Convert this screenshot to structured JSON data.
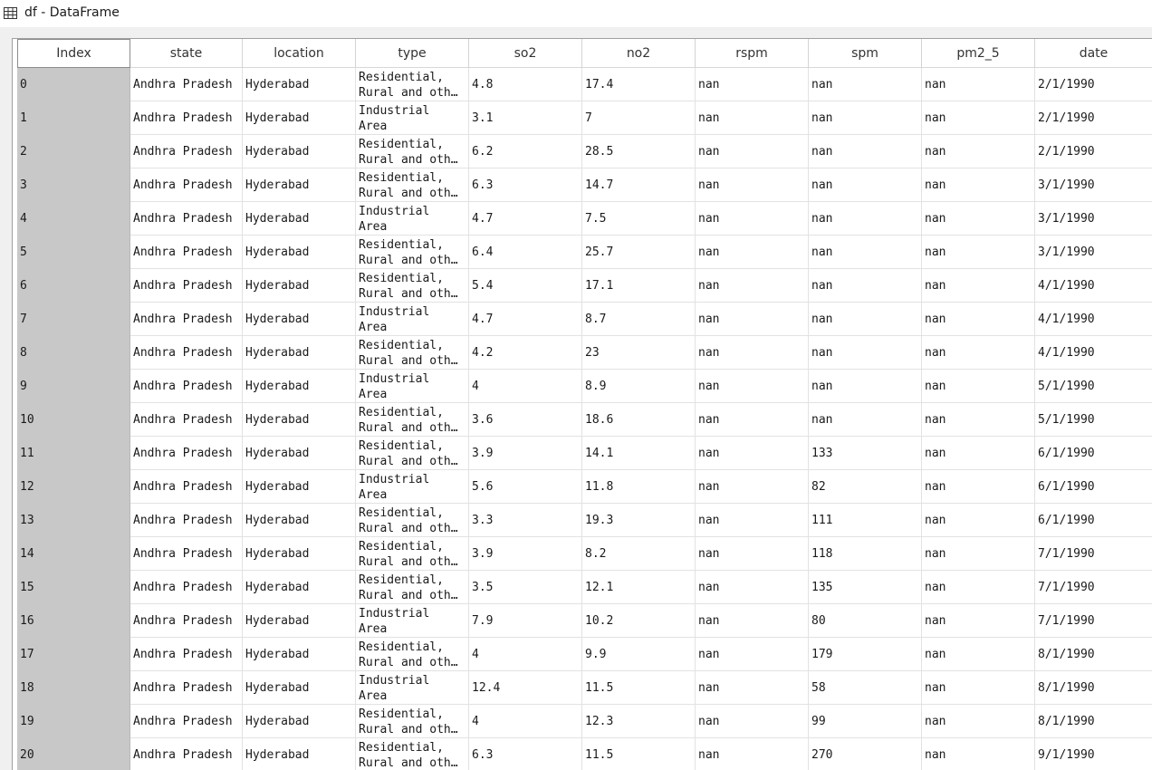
{
  "window": {
    "title": "df - DataFrame",
    "icon": "table-grid-icon"
  },
  "columns": [
    "Index",
    "state",
    "location",
    "type",
    "so2",
    "no2",
    "rspm",
    "spm",
    "pm2_5",
    "date"
  ],
  "rows": [
    {
      "index": "0",
      "state": "Andhra Pradesh",
      "location": "Hyderabad",
      "type1": "Residential,",
      "type2": "Rural and oth…",
      "so2": "4.8",
      "no2": "17.4",
      "rspm": "nan",
      "spm": "nan",
      "pm2_5": "nan",
      "date": "2/1/1990"
    },
    {
      "index": "1",
      "state": "Andhra Pradesh",
      "location": "Hyderabad",
      "type1": "Industrial",
      "type2": "Area",
      "so2": "3.1",
      "no2": "7",
      "rspm": "nan",
      "spm": "nan",
      "pm2_5": "nan",
      "date": "2/1/1990"
    },
    {
      "index": "2",
      "state": "Andhra Pradesh",
      "location": "Hyderabad",
      "type1": "Residential,",
      "type2": "Rural and oth…",
      "so2": "6.2",
      "no2": "28.5",
      "rspm": "nan",
      "spm": "nan",
      "pm2_5": "nan",
      "date": "2/1/1990"
    },
    {
      "index": "3",
      "state": "Andhra Pradesh",
      "location": "Hyderabad",
      "type1": "Residential,",
      "type2": "Rural and oth…",
      "so2": "6.3",
      "no2": "14.7",
      "rspm": "nan",
      "spm": "nan",
      "pm2_5": "nan",
      "date": "3/1/1990"
    },
    {
      "index": "4",
      "state": "Andhra Pradesh",
      "location": "Hyderabad",
      "type1": "Industrial",
      "type2": "Area",
      "so2": "4.7",
      "no2": "7.5",
      "rspm": "nan",
      "spm": "nan",
      "pm2_5": "nan",
      "date": "3/1/1990"
    },
    {
      "index": "5",
      "state": "Andhra Pradesh",
      "location": "Hyderabad",
      "type1": "Residential,",
      "type2": "Rural and oth…",
      "so2": "6.4",
      "no2": "25.7",
      "rspm": "nan",
      "spm": "nan",
      "pm2_5": "nan",
      "date": "3/1/1990"
    },
    {
      "index": "6",
      "state": "Andhra Pradesh",
      "location": "Hyderabad",
      "type1": "Residential,",
      "type2": "Rural and oth…",
      "so2": "5.4",
      "no2": "17.1",
      "rspm": "nan",
      "spm": "nan",
      "pm2_5": "nan",
      "date": "4/1/1990"
    },
    {
      "index": "7",
      "state": "Andhra Pradesh",
      "location": "Hyderabad",
      "type1": "Industrial",
      "type2": "Area",
      "so2": "4.7",
      "no2": "8.7",
      "rspm": "nan",
      "spm": "nan",
      "pm2_5": "nan",
      "date": "4/1/1990"
    },
    {
      "index": "8",
      "state": "Andhra Pradesh",
      "location": "Hyderabad",
      "type1": "Residential,",
      "type2": "Rural and oth…",
      "so2": "4.2",
      "no2": "23",
      "rspm": "nan",
      "spm": "nan",
      "pm2_5": "nan",
      "date": "4/1/1990"
    },
    {
      "index": "9",
      "state": "Andhra Pradesh",
      "location": "Hyderabad",
      "type1": "Industrial",
      "type2": "Area",
      "so2": "4",
      "no2": "8.9",
      "rspm": "nan",
      "spm": "nan",
      "pm2_5": "nan",
      "date": "5/1/1990"
    },
    {
      "index": "10",
      "state": "Andhra Pradesh",
      "location": "Hyderabad",
      "type1": "Residential,",
      "type2": "Rural and oth…",
      "so2": "3.6",
      "no2": "18.6",
      "rspm": "nan",
      "spm": "nan",
      "pm2_5": "nan",
      "date": "5/1/1990"
    },
    {
      "index": "11",
      "state": "Andhra Pradesh",
      "location": "Hyderabad",
      "type1": "Residential,",
      "type2": "Rural and oth…",
      "so2": "3.9",
      "no2": "14.1",
      "rspm": "nan",
      "spm": "133",
      "pm2_5": "nan",
      "date": "6/1/1990"
    },
    {
      "index": "12",
      "state": "Andhra Pradesh",
      "location": "Hyderabad",
      "type1": "Industrial",
      "type2": "Area",
      "so2": "5.6",
      "no2": "11.8",
      "rspm": "nan",
      "spm": "82",
      "pm2_5": "nan",
      "date": "6/1/1990"
    },
    {
      "index": "13",
      "state": "Andhra Pradesh",
      "location": "Hyderabad",
      "type1": "Residential,",
      "type2": "Rural and oth…",
      "so2": "3.3",
      "no2": "19.3",
      "rspm": "nan",
      "spm": "111",
      "pm2_5": "nan",
      "date": "6/1/1990"
    },
    {
      "index": "14",
      "state": "Andhra Pradesh",
      "location": "Hyderabad",
      "type1": "Residential,",
      "type2": "Rural and oth…",
      "so2": "3.9",
      "no2": "8.2",
      "rspm": "nan",
      "spm": "118",
      "pm2_5": "nan",
      "date": "7/1/1990"
    },
    {
      "index": "15",
      "state": "Andhra Pradesh",
      "location": "Hyderabad",
      "type1": "Residential,",
      "type2": "Rural and oth…",
      "so2": "3.5",
      "no2": "12.1",
      "rspm": "nan",
      "spm": "135",
      "pm2_5": "nan",
      "date": "7/1/1990"
    },
    {
      "index": "16",
      "state": "Andhra Pradesh",
      "location": "Hyderabad",
      "type1": "Industrial",
      "type2": "Area",
      "so2": "7.9",
      "no2": "10.2",
      "rspm": "nan",
      "spm": "80",
      "pm2_5": "nan",
      "date": "7/1/1990"
    },
    {
      "index": "17",
      "state": "Andhra Pradesh",
      "location": "Hyderabad",
      "type1": "Residential,",
      "type2": "Rural and oth…",
      "so2": "4",
      "no2": "9.9",
      "rspm": "nan",
      "spm": "179",
      "pm2_5": "nan",
      "date": "8/1/1990"
    },
    {
      "index": "18",
      "state": "Andhra Pradesh",
      "location": "Hyderabad",
      "type1": "Industrial",
      "type2": "Area",
      "so2": "12.4",
      "no2": "11.5",
      "rspm": "nan",
      "spm": "58",
      "pm2_5": "nan",
      "date": "8/1/1990"
    },
    {
      "index": "19",
      "state": "Andhra Pradesh",
      "location": "Hyderabad",
      "type1": "Residential,",
      "type2": "Rural and oth…",
      "so2": "4",
      "no2": "12.3",
      "rspm": "nan",
      "spm": "99",
      "pm2_5": "nan",
      "date": "8/1/1990"
    },
    {
      "index": "20",
      "state": "Andhra Pradesh",
      "location": "Hyderabad",
      "type1": "Residential,",
      "type2": "Rural and oth…",
      "so2": "6.3",
      "no2": "11.5",
      "rspm": "nan",
      "spm": "270",
      "pm2_5": "nan",
      "date": "9/1/1990"
    }
  ]
}
